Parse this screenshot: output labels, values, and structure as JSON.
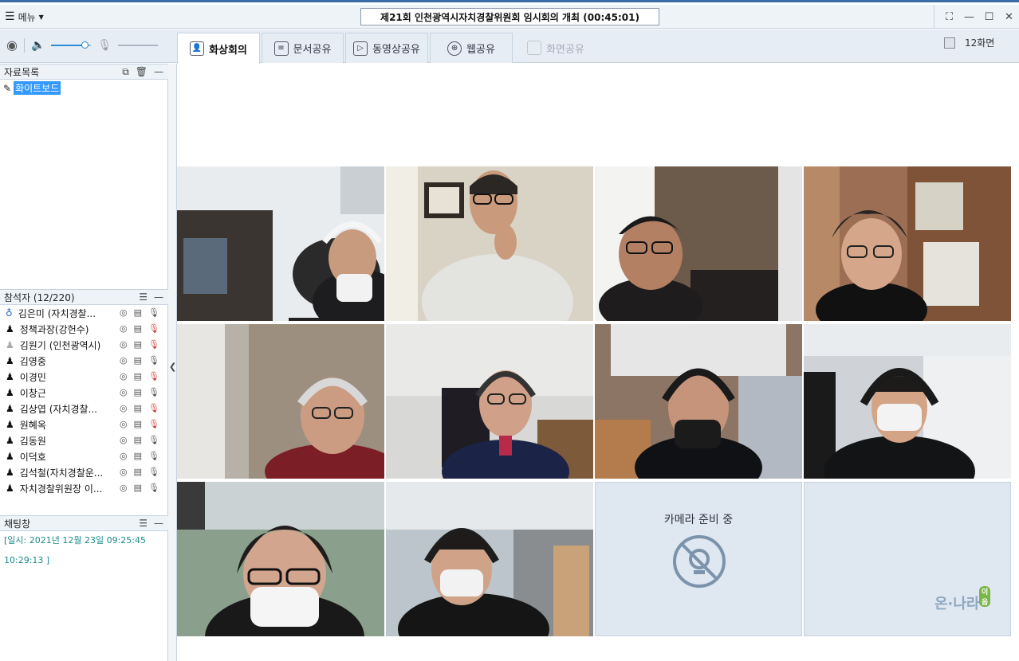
{
  "titlebar": {
    "menu_label": "메뉴",
    "meeting_title": "제21회 인천광역시자치경찰위원회 임시회의 개최 (00:45:01)"
  },
  "toolbar": {
    "speaker_volume": 0.85,
    "mic_volume": 0.0,
    "tabs": [
      {
        "label": "화상회의",
        "icon": "user-icon"
      },
      {
        "label": "문서공유",
        "icon": "document-icon"
      },
      {
        "label": "동영상공유",
        "icon": "play-icon"
      },
      {
        "label": "웹공유",
        "icon": "globe-icon"
      },
      {
        "label": "화면공유",
        "icon": "screen-icon"
      }
    ],
    "layout_label": "12화면"
  },
  "resources": {
    "title": "자료목록",
    "items": [
      {
        "label": "화이트보드"
      }
    ]
  },
  "participants": {
    "title": "참석자 (12/220)",
    "list": [
      {
        "name": "김은미 (자치경찰..."
      },
      {
        "name": "정책과장(강헌수)"
      },
      {
        "name": "김원기 (인천광역시)"
      },
      {
        "name": "김영중"
      },
      {
        "name": "이경민"
      },
      {
        "name": "이창근"
      },
      {
        "name": "김상엽 (자치경찰..."
      },
      {
        "name": "원혜옥"
      },
      {
        "name": "김동원"
      },
      {
        "name": "이덕호"
      },
      {
        "name": "김석철(자치경찰운..."
      },
      {
        "name": "자치경찰위원장 이..."
      }
    ]
  },
  "chat": {
    "title": "채팅창",
    "lines": [
      "[일시: 2021년 12월 23일 09:25:45",
      "10:29:13 ]"
    ]
  },
  "video": {
    "camera_waiting": "카메라 준비 중",
    "logo_text": "온·나라",
    "logo_badge": "이음"
  }
}
